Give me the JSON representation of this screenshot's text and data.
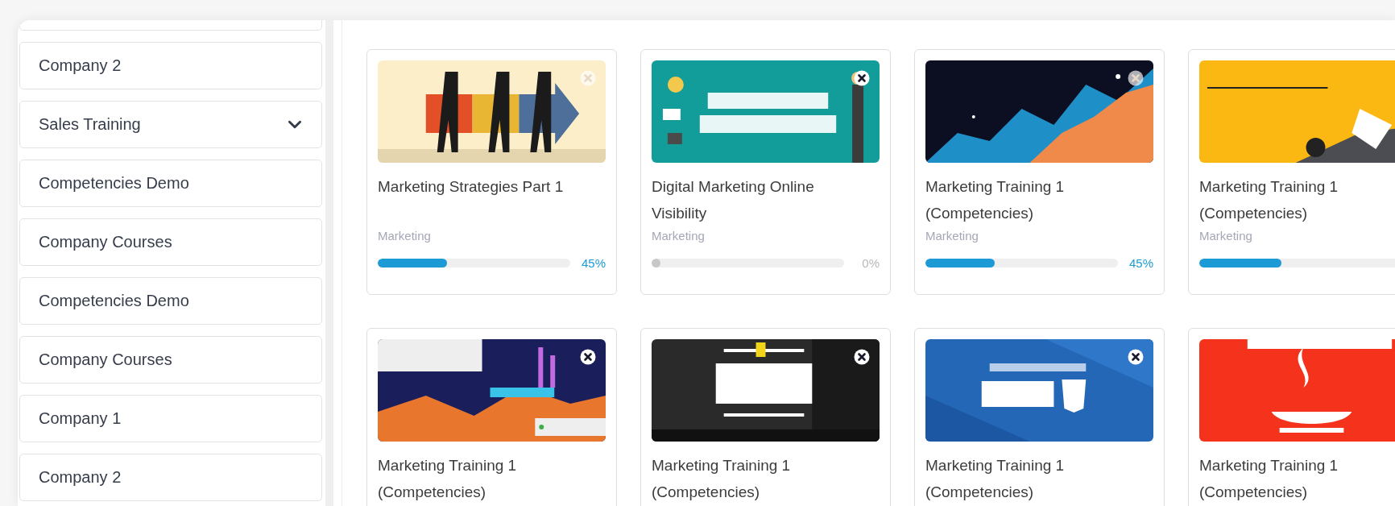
{
  "sidebar": {
    "items": [
      {
        "label": "Company 2",
        "expandable": false
      },
      {
        "label": "Sales Training",
        "expandable": true
      },
      {
        "label": "Competencies Demo",
        "expandable": false
      },
      {
        "label": "Company Courses",
        "expandable": false
      },
      {
        "label": "Competencies Demo",
        "expandable": false
      },
      {
        "label": "Company Courses",
        "expandable": false
      },
      {
        "label": "Company 1",
        "expandable": false
      },
      {
        "label": "Company 2",
        "expandable": false
      }
    ]
  },
  "courses": [
    {
      "close_dimmed": true,
      "title": "Marketing Strategies Part 1",
      "category": "Marketing",
      "level": 0.36,
      "percent": "45%"
    },
    {
      "close_dimmed": false,
      "title": "Digital Marketing Online Visibility",
      "category": "Marketing",
      "level": 0,
      "percent": "0%"
    },
    {
      "close_dimmed": true,
      "title": "Marketing Training 1 (Competencies)",
      "category": "Marketing",
      "level": 0.36,
      "percent": "45%"
    },
    {
      "title": "Marketing Training 1 (Competencies)",
      "category": "Marketing",
      "level": 0.36
    },
    {
      "close_dimmed": false,
      "title": "Marketing Training 1 (Competencies)"
    },
    {
      "close_dimmed": false,
      "title": "Marketing Training 1 (Competencies)"
    },
    {
      "close_dimmed": false,
      "title": "Marketing Training 1 (Competencies)"
    },
    {
      "title": "Marketing Training 1 (Competencies)"
    }
  ]
}
